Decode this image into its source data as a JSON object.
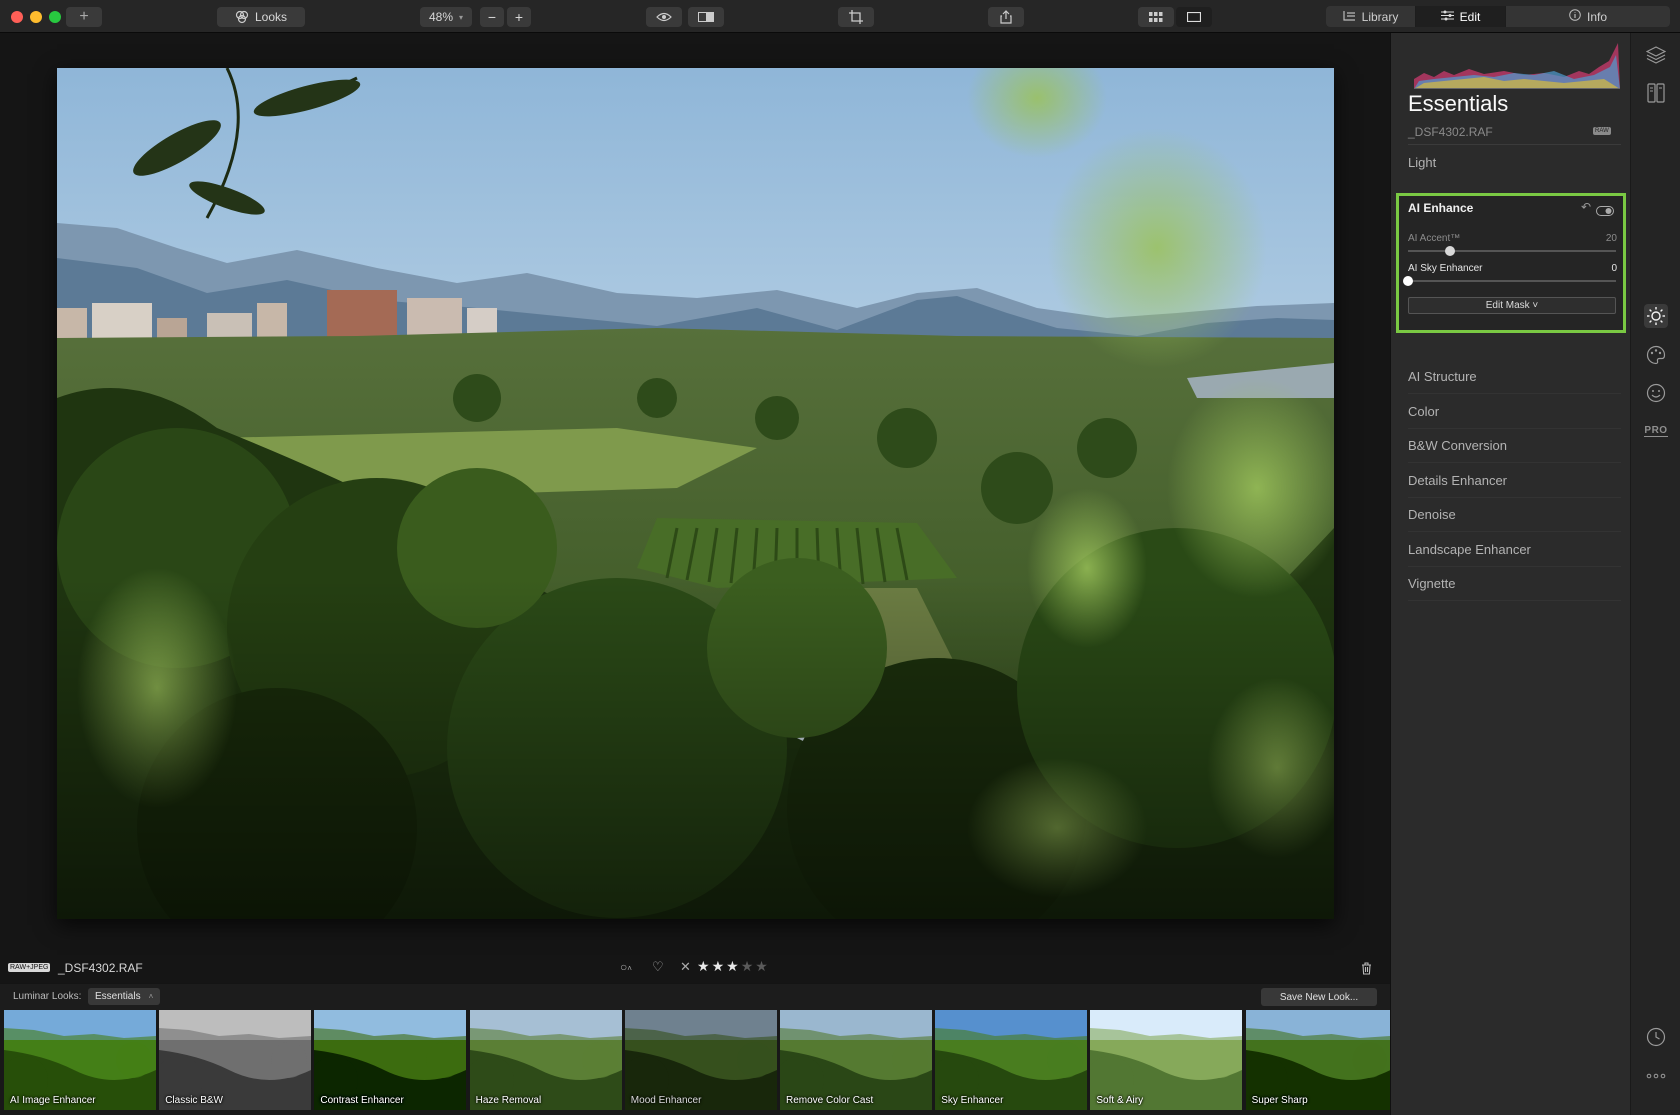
{
  "toolbar": {
    "add_label": "+",
    "looks_label": "Looks",
    "zoom_value": "48%",
    "zoom_out": "−",
    "zoom_in": "+",
    "tabs": {
      "library": "Library",
      "edit": "Edit",
      "info": "Info"
    }
  },
  "right_panel": {
    "title": "Essentials",
    "filename": "_DSF4302.RAF",
    "raw_badge": "RAW",
    "light_label": "Light",
    "ai_enhance": {
      "title": "AI Enhance",
      "accent_label": "AI Accent™",
      "accent_value": "20",
      "accent_fraction": 0.2,
      "sky_label": "AI Sky Enhancer",
      "sky_value": "0",
      "sky_fraction": 0,
      "edit_mask": "Edit Mask ˅"
    },
    "tools": [
      "AI Structure",
      "Color",
      "B&W Conversion",
      "Details Enhancer",
      "Denoise",
      "Landscape Enhancer",
      "Vignette"
    ]
  },
  "rail": {
    "pro_label": "PRO"
  },
  "info_strip": {
    "format_badge": "RAW+JPEG",
    "filename": "_DSF4302.RAF",
    "rating": 3,
    "max_rating": 5
  },
  "looks_bar": {
    "label": "Luminar Looks:",
    "selected": "Essentials",
    "save_button": "Save New Look..."
  },
  "looks": [
    {
      "name": "AI Image Enhancer",
      "tone": "vivid"
    },
    {
      "name": "Classic B&W",
      "tone": "bw"
    },
    {
      "name": "Contrast Enhancer",
      "tone": "contrast"
    },
    {
      "name": "Haze Removal",
      "tone": "haze"
    },
    {
      "name": "Mood Enhancer",
      "tone": "mood"
    },
    {
      "name": "Remove Color Cast",
      "tone": "neutral"
    },
    {
      "name": "Sky Enhancer",
      "tone": "sky"
    },
    {
      "name": "Soft & Airy",
      "tone": "soft"
    },
    {
      "name": "Super Sharp",
      "tone": "sharp"
    }
  ]
}
